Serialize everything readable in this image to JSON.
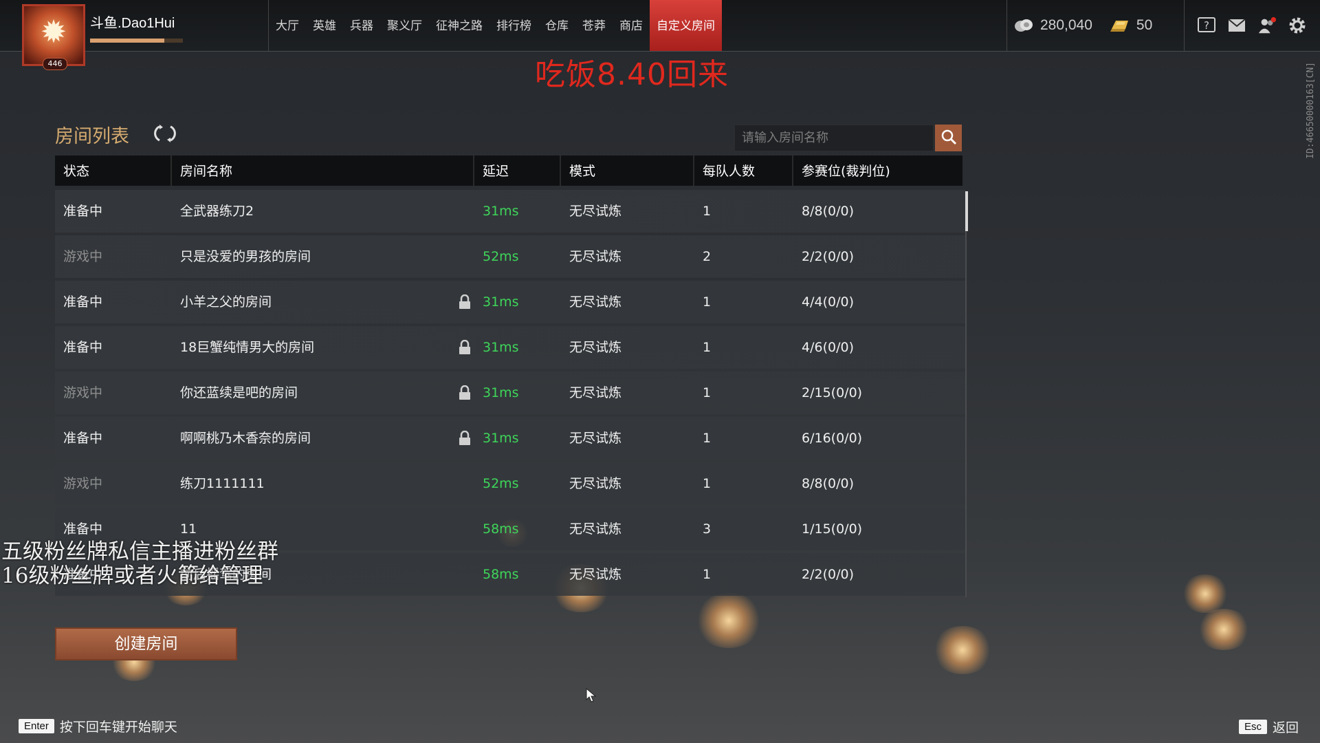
{
  "player": {
    "name": "斗鱼.Dao1Hui",
    "level": "446",
    "xp_fraction": 0.8
  },
  "nav": {
    "items": [
      {
        "label": "大厅"
      },
      {
        "label": "英雄"
      },
      {
        "label": "兵器"
      },
      {
        "label": "聚义厅"
      },
      {
        "label": "征神之路"
      },
      {
        "label": "排行榜"
      },
      {
        "label": "仓库"
      },
      {
        "label": "苍莽"
      },
      {
        "label": "商店"
      },
      {
        "label": "自定义房间",
        "active": true
      }
    ]
  },
  "currency": {
    "coins": "280,040",
    "gold": "50"
  },
  "notice": "吃饭8.40回来",
  "side_id": "ID:46650000163[CN]",
  "room_list": {
    "title": "房间列表",
    "search_placeholder": "请输入房间名称",
    "headers": [
      "状态",
      "房间名称",
      "延迟",
      "模式",
      "每队人数",
      "参赛位(裁判位)"
    ],
    "rows": [
      {
        "status": "准备中",
        "name": "全武器练刀2",
        "locked": false,
        "ping": "31ms",
        "mode": "无尽试炼",
        "team_size": "1",
        "slots": "8/8(0/0)",
        "playing": false
      },
      {
        "status": "游戏中",
        "name": "只是没爱的男孩的房间",
        "locked": false,
        "ping": "52ms",
        "mode": "无尽试炼",
        "team_size": "2",
        "slots": "2/2(0/0)",
        "playing": true
      },
      {
        "status": "准备中",
        "name": "小羊之父的房间",
        "locked": true,
        "ping": "31ms",
        "mode": "无尽试炼",
        "team_size": "1",
        "slots": "4/4(0/0)",
        "playing": false
      },
      {
        "status": "准备中",
        "name": "18巨蟹纯情男大的房间",
        "locked": true,
        "ping": "31ms",
        "mode": "无尽试炼",
        "team_size": "1",
        "slots": "4/6(0/0)",
        "playing": false
      },
      {
        "status": "游戏中",
        "name": "你还蓝续是吧的房间",
        "locked": true,
        "ping": "31ms",
        "mode": "无尽试炼",
        "team_size": "1",
        "slots": "2/15(0/0)",
        "playing": true
      },
      {
        "status": "准备中",
        "name": "啊啊桃乃木香奈的房间",
        "locked": true,
        "ping": "31ms",
        "mode": "无尽试炼",
        "team_size": "1",
        "slots": "6/16(0/0)",
        "playing": false
      },
      {
        "status": "游戏中",
        "name": "练刀1111111",
        "locked": false,
        "ping": "52ms",
        "mode": "无尽试炼",
        "team_size": "1",
        "slots": "8/8(0/0)",
        "playing": true
      },
      {
        "status": "准备中",
        "name": "11",
        "locked": false,
        "ping": "58ms",
        "mode": "无尽试炼",
        "team_size": "3",
        "slots": "1/15(0/0)",
        "playing": false
      },
      {
        "status": "准备中",
        "name": "前后摇驾的房间",
        "locked": false,
        "ping": "58ms",
        "mode": "无尽试炼",
        "team_size": "1",
        "slots": "2/2(0/0)",
        "playing": false
      }
    ]
  },
  "create_button": "创建房间",
  "overlay": {
    "line1": "五级粉丝牌私信主播进粉丝群",
    "line2": "16级粉丝牌或者火箭给管理"
  },
  "hints": {
    "chat_key": "Enter",
    "chat_text": "按下回车键开始聊天",
    "back_key": "Esc",
    "back_text": "返回"
  },
  "colors": {
    "accent_red": "#e0281e",
    "title_gold": "#d6ab70",
    "ping_green": "#3ed65a",
    "button_brown": "#a05a3a"
  }
}
